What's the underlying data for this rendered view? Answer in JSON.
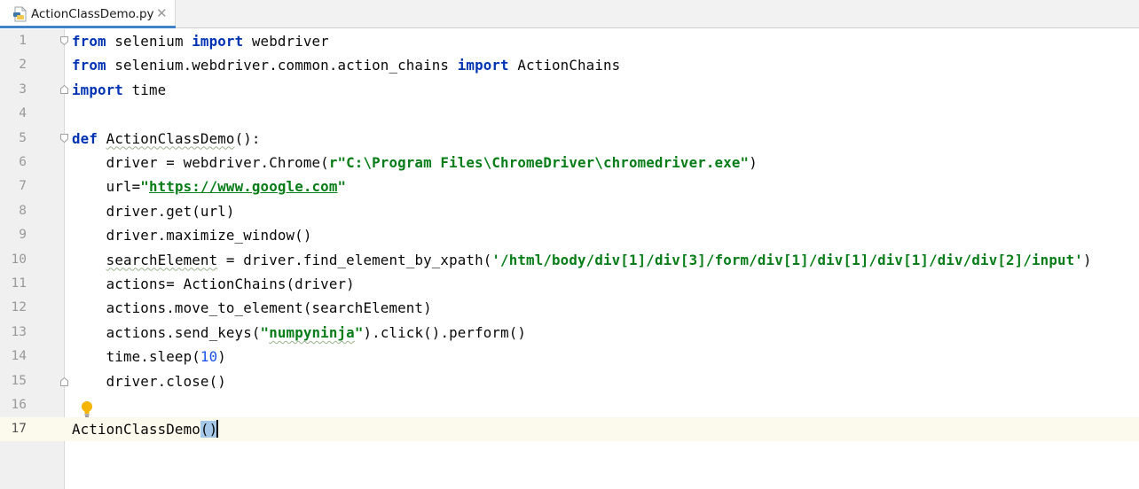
{
  "tab": {
    "filename": "ActionClassDemo.py",
    "close_symbol": "✕",
    "icon": "python-file-icon"
  },
  "colors": {
    "keyword": "#0033b3",
    "string": "#067d17",
    "number": "#1750eb",
    "current_line": "#fcfaed",
    "brace_match": "#a6c8e8",
    "tab_underline": "#4083c9"
  },
  "editor": {
    "current_line": 17,
    "lines": [
      {
        "n": "1",
        "tokens": [
          {
            "t": "from",
            "c": "kw"
          },
          {
            "t": " selenium "
          },
          {
            "t": "import",
            "c": "kw"
          },
          {
            "t": " webdriver"
          }
        ]
      },
      {
        "n": "2",
        "tokens": [
          {
            "t": "from",
            "c": "kw"
          },
          {
            "t": " selenium.webdriver.common.action_chains "
          },
          {
            "t": "import",
            "c": "kw"
          },
          {
            "t": " ActionChains"
          }
        ]
      },
      {
        "n": "3",
        "tokens": [
          {
            "t": "import",
            "c": "kw"
          },
          {
            "t": " time"
          }
        ]
      },
      {
        "n": "4",
        "tokens": []
      },
      {
        "n": "5",
        "tokens": [
          {
            "t": "def",
            "c": "kw"
          },
          {
            "t": " "
          },
          {
            "t": "ActionClassDemo",
            "c": "typo"
          },
          {
            "t": "():"
          }
        ]
      },
      {
        "n": "6",
        "tokens": [
          {
            "t": "    driver = webdriver.Chrome("
          },
          {
            "t": "r\"C:\\Program Files\\ChromeDriver\\chromedriver.exe\"",
            "c": "str"
          },
          {
            "t": ")"
          }
        ]
      },
      {
        "n": "7",
        "tokens": [
          {
            "t": "    url="
          },
          {
            "t": "\"",
            "c": "str"
          },
          {
            "t": "https://www.google.com",
            "c": "link"
          },
          {
            "t": "\"",
            "c": "str"
          }
        ]
      },
      {
        "n": "8",
        "tokens": [
          {
            "t": "    driver.get(url)"
          }
        ]
      },
      {
        "n": "9",
        "tokens": [
          {
            "t": "    driver.maximize_window()"
          }
        ]
      },
      {
        "n": "10",
        "tokens": [
          {
            "t": "    "
          },
          {
            "t": "searchElement",
            "c": "typo"
          },
          {
            "t": " = driver.find_element_by_xpath("
          },
          {
            "t": "'/html/body/div[1]/div[3]/form/div[1]/div[1]/div[1]/div/div[2]/input'",
            "c": "str"
          },
          {
            "t": ")"
          }
        ]
      },
      {
        "n": "11",
        "tokens": [
          {
            "t": "    actions= ActionChains(driver)"
          }
        ]
      },
      {
        "n": "12",
        "tokens": [
          {
            "t": "    actions.move_to_element(searchElement)"
          }
        ]
      },
      {
        "n": "13",
        "tokens": [
          {
            "t": "    actions.send_keys("
          },
          {
            "t": "\"",
            "c": "str"
          },
          {
            "t": "numpyninja",
            "c": "str typo"
          },
          {
            "t": "\"",
            "c": "str"
          },
          {
            "t": ").click().perform()"
          }
        ]
      },
      {
        "n": "14",
        "tokens": [
          {
            "t": "    time.sleep("
          },
          {
            "t": "10",
            "c": "num"
          },
          {
            "t": ")"
          }
        ]
      },
      {
        "n": "15",
        "tokens": [
          {
            "t": "    driver.close()"
          }
        ]
      },
      {
        "n": "16",
        "tokens": []
      },
      {
        "n": "17",
        "tokens": [
          {
            "t": "ActionClassDemo"
          },
          {
            "t": "()",
            "c": "brace-match"
          },
          {
            "t": "",
            "c": "caret"
          }
        ]
      }
    ]
  }
}
